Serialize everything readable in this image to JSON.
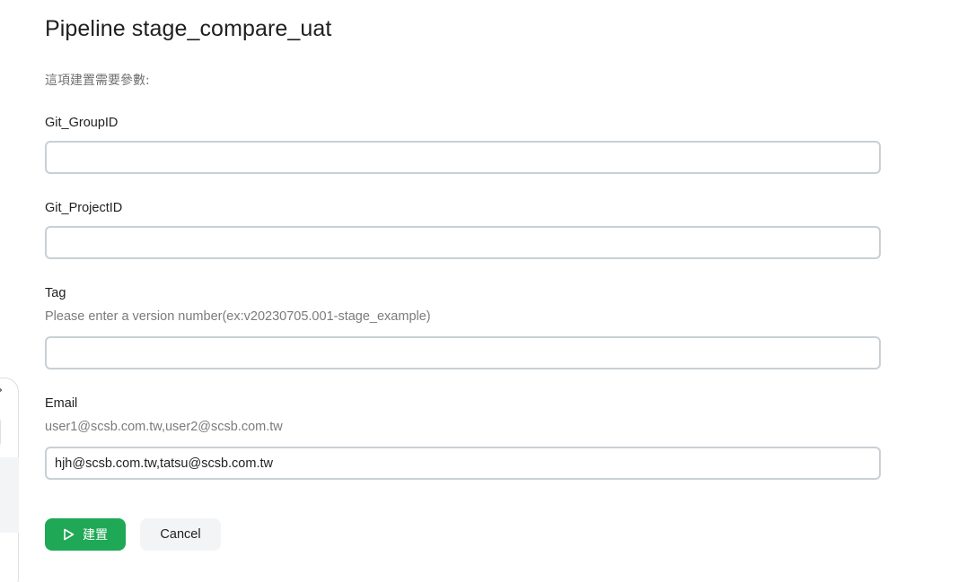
{
  "dialog": {
    "title": "Pipeline stage_compare_uat",
    "intro": "這項建置需要參數:"
  },
  "fields": [
    {
      "label": "Git_GroupID",
      "description": "",
      "value": ""
    },
    {
      "label": "Git_ProjectID",
      "description": "",
      "value": ""
    },
    {
      "label": "Tag",
      "description": "Please enter a version number(ex:v20230705.001-stage_example)",
      "value": ""
    },
    {
      "label": "Email",
      "description": "user1@scsb.com.tw,user2@scsb.com.tw",
      "value": "hjh@scsb.com.tw,tatsu@scsb.com.tw"
    }
  ],
  "actions": {
    "build_label": "建置",
    "build_icon": "play-icon",
    "cancel_label": "Cancel"
  },
  "colors": {
    "primary": "#1fa855",
    "input_border": "#c9d0d4",
    "secondary_button": "#f3f4f6"
  }
}
